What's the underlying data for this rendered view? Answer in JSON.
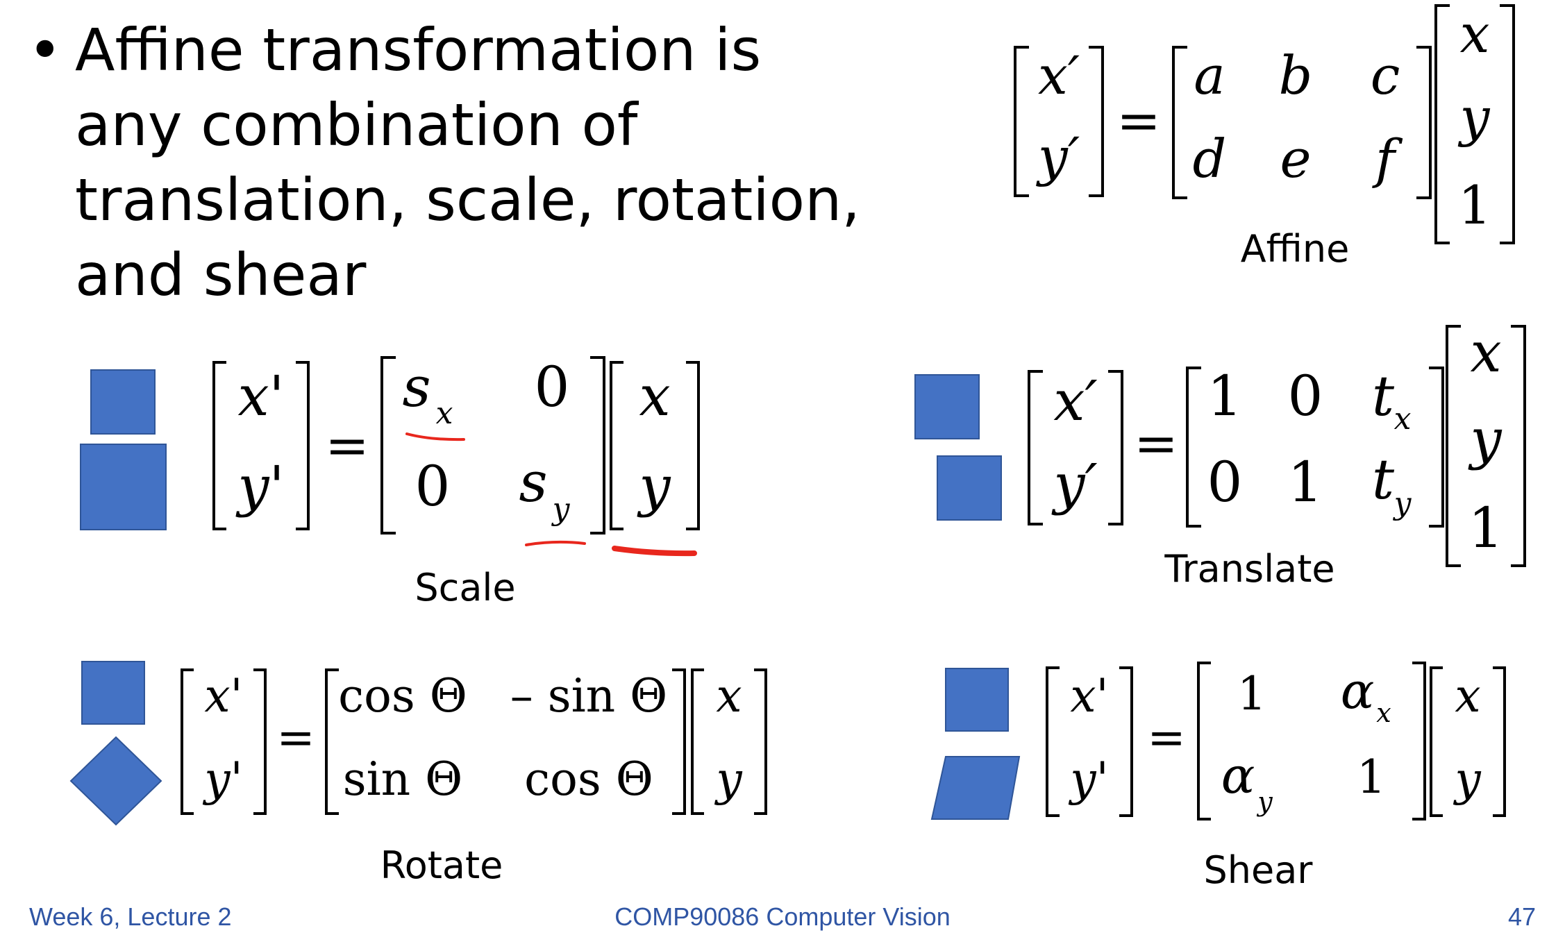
{
  "bullet": {
    "marker": "•",
    "text": "Affine transformation is any combination of translation, scale, rotation, and shear"
  },
  "captions": {
    "affine": "Affine",
    "scale": "Scale",
    "translate": "Translate",
    "rotate": "Rotate",
    "shear": "Shear"
  },
  "footer": {
    "left": "Week 6, Lecture 2",
    "center": "COMP90086 Computer Vision",
    "right": "47"
  },
  "colors": {
    "shape_fill": "#4472c4",
    "shape_stroke": "#2f5597",
    "footer_text": "#2f55a4",
    "annotation": "#e8271d"
  },
  "equations": {
    "affine": {
      "lhs": [
        "x′",
        "y′"
      ],
      "matrix": [
        [
          "a",
          "b",
          "c"
        ],
        [
          "d",
          "e",
          "f"
        ]
      ],
      "vec": [
        "x",
        "y",
        "1"
      ]
    },
    "scale": {
      "lhs": [
        "x'",
        "y'"
      ],
      "matrix": [
        [
          "s",
          "0"
        ],
        [
          "0",
          "s"
        ]
      ],
      "subscripts": [
        "x",
        "y"
      ],
      "vec": [
        "x",
        "y"
      ]
    },
    "translate": {
      "lhs": [
        "x′",
        "y′"
      ],
      "matrix": [
        [
          "1",
          "0",
          "t"
        ],
        [
          "0",
          "1",
          "t"
        ]
      ],
      "subscripts": [
        "x",
        "y"
      ],
      "vec": [
        "x",
        "y",
        "1"
      ]
    },
    "rotate": {
      "lhs": [
        "x'",
        "y'"
      ],
      "matrix": [
        [
          "cos Θ",
          "– sin Θ"
        ],
        [
          "sin Θ",
          "cos Θ"
        ]
      ],
      "vec": [
        "x",
        "y"
      ]
    },
    "shear": {
      "lhs": [
        "x'",
        "y'"
      ],
      "matrix": [
        [
          "1",
          "α"
        ],
        [
          "α",
          "1"
        ]
      ],
      "subscripts": [
        "x",
        "y"
      ],
      "vec": [
        "x",
        "y"
      ]
    }
  }
}
